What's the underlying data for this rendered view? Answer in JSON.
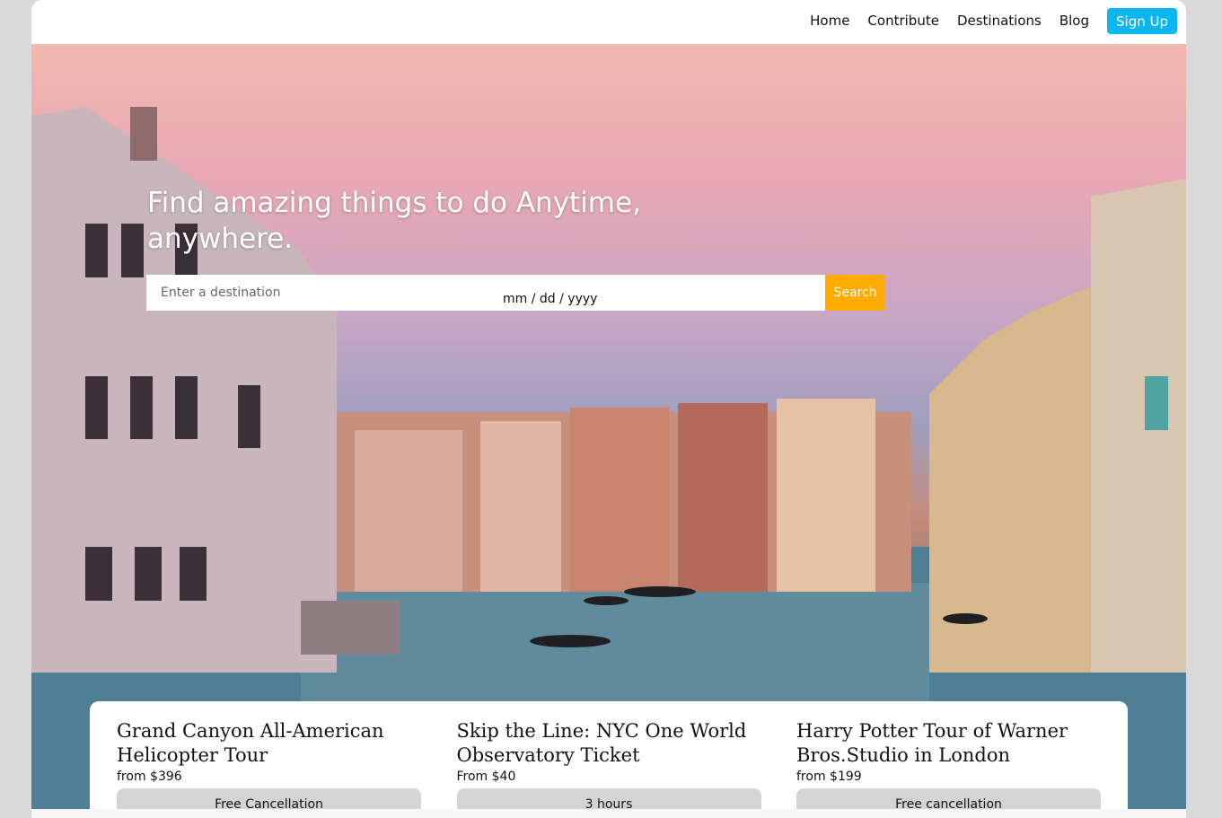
{
  "nav": {
    "links": [
      "Home",
      "Contribute",
      "Destinations",
      "Blog"
    ],
    "signup_label": "Sign Up"
  },
  "hero": {
    "title": "Find amazing things to do Anytime, anywhere.",
    "search": {
      "destination_placeholder": "Enter a destination",
      "date_placeholder": "mm / dd / yyyy",
      "button_label": "Search"
    }
  },
  "tours": [
    {
      "title": "Grand Canyon All-American Helicopter Tour",
      "price": "from $396",
      "badge": "Free Cancellation"
    },
    {
      "title": "Skip the Line: NYC One World Observatory Ticket",
      "price": "From $40",
      "badge": "3 hours"
    },
    {
      "title": "Harry Potter Tour of Warner Bros.Studio in London",
      "price": "from $199",
      "badge": "Free cancellation"
    }
  ],
  "colors": {
    "accent_signup": "#0bb6f0",
    "accent_search": "#ffab00",
    "badge_bg": "#d4d4d4"
  }
}
